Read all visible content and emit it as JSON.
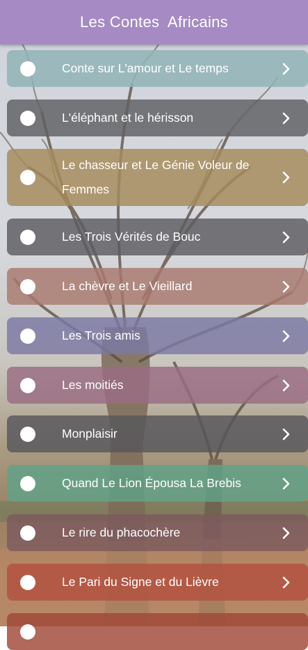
{
  "app": {
    "title": "Les Contes  Africains"
  },
  "stories": [
    {
      "label": "Conte sur L'amour et Le temps",
      "color": "#8fb2b6"
    },
    {
      "label": "L'éléphant et le hérisson",
      "color": "#5f5f63"
    },
    {
      "label": "Le chasseur et Le Génie Voleur de Femmes",
      "color": "#a58a5a"
    },
    {
      "label": "Les Trois Vérités de Bouc",
      "color": "#5c5c60"
    },
    {
      "label": "La chèvre et Le Vieillard",
      "color": "#a8796f"
    },
    {
      "label": "Les Trois amis",
      "color": "#7b79a4"
    },
    {
      "label": "Les moitiés",
      "color": "#9a6d83"
    },
    {
      "label": "Monplaisir",
      "color": "#57575c"
    },
    {
      "label": "Quand Le Lion Épousa La Brebis",
      "color": "#5fa287"
    },
    {
      "label": "Le rire du phacochère",
      "color": "#7d5a5e"
    },
    {
      "label": "Le Pari du Signe et du Lièvre",
      "color": "#b2513f"
    },
    {
      "label": "",
      "color": "#a04838"
    }
  ],
  "icons": {
    "bullet": "circle-bullet-icon",
    "chevron": "chevron-right-icon"
  }
}
